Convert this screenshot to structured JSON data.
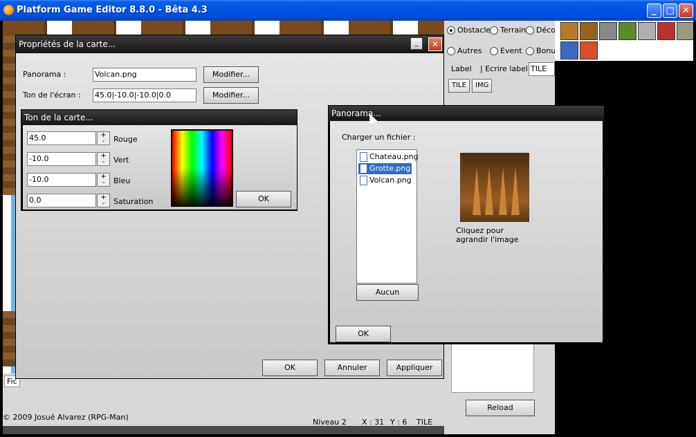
{
  "window": {
    "title": "Platform Game Editor 8.8.0 - Bêta 4.3"
  },
  "right_panel": {
    "radios": [
      {
        "label": "Obstacle",
        "checked": true
      },
      {
        "label": "Terrain",
        "checked": false
      },
      {
        "label": "Décor",
        "checked": false
      },
      {
        "label": "Autres",
        "checked": false
      },
      {
        "label": "Event",
        "checked": false
      },
      {
        "label": "Bonus",
        "checked": false
      }
    ],
    "label_text": "Label",
    "ecrire_label": "| Ecrire label :",
    "label_value": "TILE",
    "btn_tile": "TILE",
    "btn_img": "IMG",
    "reload": "Reload"
  },
  "props_dialog": {
    "title": "Propriétés de la carte...",
    "panorama_label": "Panorama :",
    "panorama_value": "Volcan.png",
    "ton_label": "Ton de l'écran :",
    "ton_value": "45.0|-10.0|-10.0|0.0",
    "modifier": "Modifier...",
    "ok": "OK",
    "annuler": "Annuler",
    "appliquer": "Appliquer"
  },
  "ton_dialog": {
    "title": "Ton de la carte...",
    "rows": [
      {
        "value": "45.0",
        "label": "Rouge"
      },
      {
        "value": "-10.0",
        "label": "Vert"
      },
      {
        "value": "-10.0",
        "label": "Bleu"
      },
      {
        "value": "0.0",
        "label": "Saturation"
      }
    ],
    "plus": "+",
    "minus": "-",
    "ok": "OK"
  },
  "panorama_dialog": {
    "title": "Panorama...",
    "charger": "Charger un fichier :",
    "files": [
      {
        "name": "Chateau.png",
        "selected": false
      },
      {
        "name": "Grotte.png",
        "selected": true
      },
      {
        "name": "Volcan.png",
        "selected": false
      }
    ],
    "aucun": "Aucun",
    "preview_caption_1": "Cliquez pour",
    "preview_caption_2": "agrandir l'image",
    "ok": "OK"
  },
  "status": {
    "copyright": "© 2009 Josué Alvarez (RPG-Man)",
    "niveau": "Niveau 2",
    "x": "X : 31",
    "y": "Y : 6",
    "mode": "TILE",
    "menu_stub": "Fic"
  }
}
